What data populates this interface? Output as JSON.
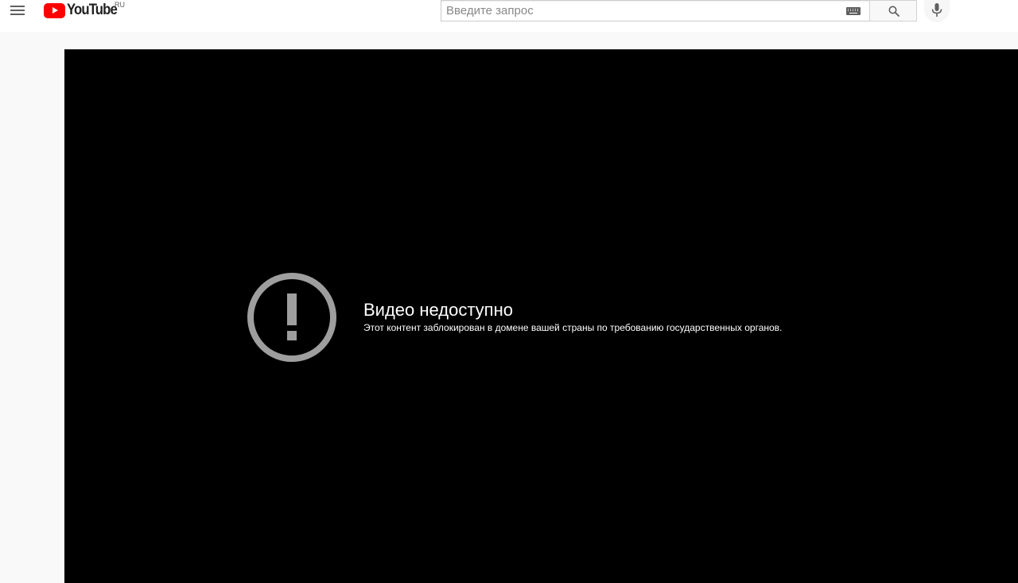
{
  "header": {
    "logo_text": "YouTube",
    "country_code": "RU",
    "menu_icon": "hamburger-menu-icon",
    "search": {
      "placeholder": "Введите запрос",
      "value": "",
      "keyboard_icon": "keyboard-icon",
      "search_icon": "search-icon"
    },
    "voice_icon": "microphone-icon"
  },
  "player": {
    "error_icon": "exclamation-circle-icon",
    "error_title": "Видео недоступно",
    "error_message": "Этот контент заблокирован в домене вашей страны по требованию государственных органов."
  },
  "colors": {
    "brand_red": "#ff0000",
    "player_bg": "#000000",
    "error_icon_gray": "#9e9e9e",
    "page_bg": "#f9f9f9"
  }
}
